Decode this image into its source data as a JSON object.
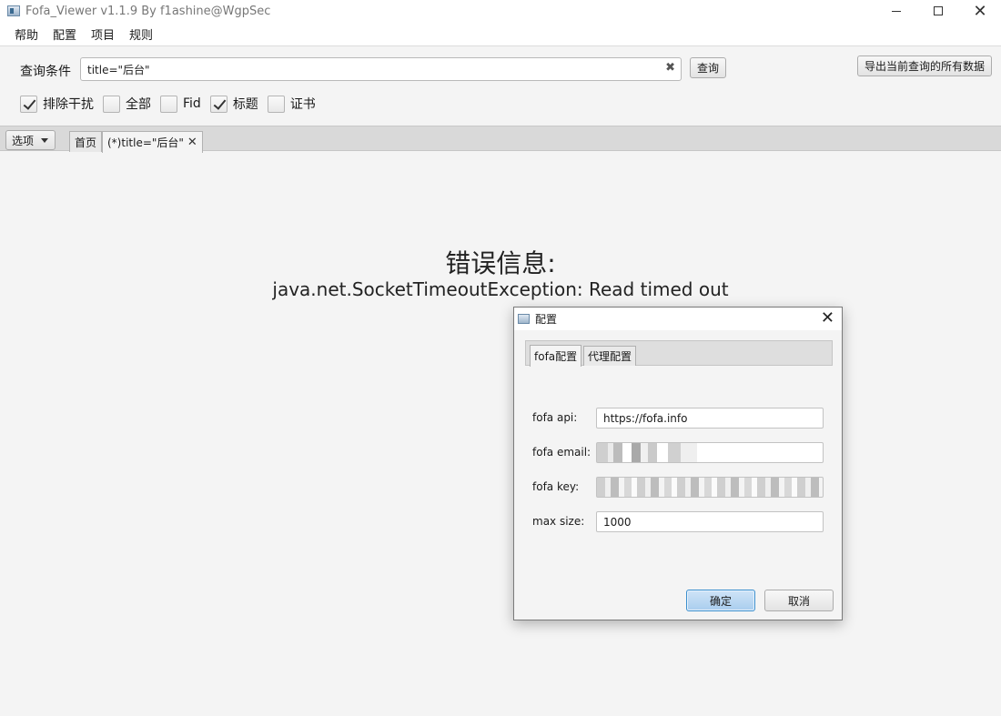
{
  "window": {
    "title": "Fofa_Viewer v1.1.9 By f1ashine@WgpSec",
    "close_glyph": "✕"
  },
  "menu": [
    "帮助",
    "配置",
    "项目",
    "规则"
  ],
  "query": {
    "label": "查询条件",
    "value": "title=\"后台\"",
    "clear_glyph": "✖",
    "search_button": "查询",
    "export_button": "导出当前查询的所有数据"
  },
  "filters": [
    {
      "label": "排除干扰",
      "checked": true
    },
    {
      "label": "全部",
      "checked": false
    },
    {
      "label": "Fid",
      "checked": false
    },
    {
      "label": "标题",
      "checked": true
    },
    {
      "label": "证书",
      "checked": false
    }
  ],
  "tabs": {
    "options_label": "选项",
    "home": "首页",
    "query_tab": "(*)title=\"后台\"",
    "close_glyph": "✕"
  },
  "error": {
    "title": "错误信息:",
    "message": "java.net.SocketTimeoutException: Read timed out"
  },
  "dialog": {
    "title": "配置",
    "close_glyph": "✕",
    "tabs": [
      "fofa配置",
      "代理配置"
    ],
    "fields": {
      "api_label": "fofa api:",
      "api_value": "https://fofa.info",
      "email_label": "fofa email:",
      "key_label": "fofa key:",
      "size_label": "max size:",
      "size_value": "1000"
    },
    "ok_button": "确定",
    "cancel_button": "取消"
  },
  "colors": {
    "background": "#f4f4f4",
    "accent": "#3b8fce"
  }
}
